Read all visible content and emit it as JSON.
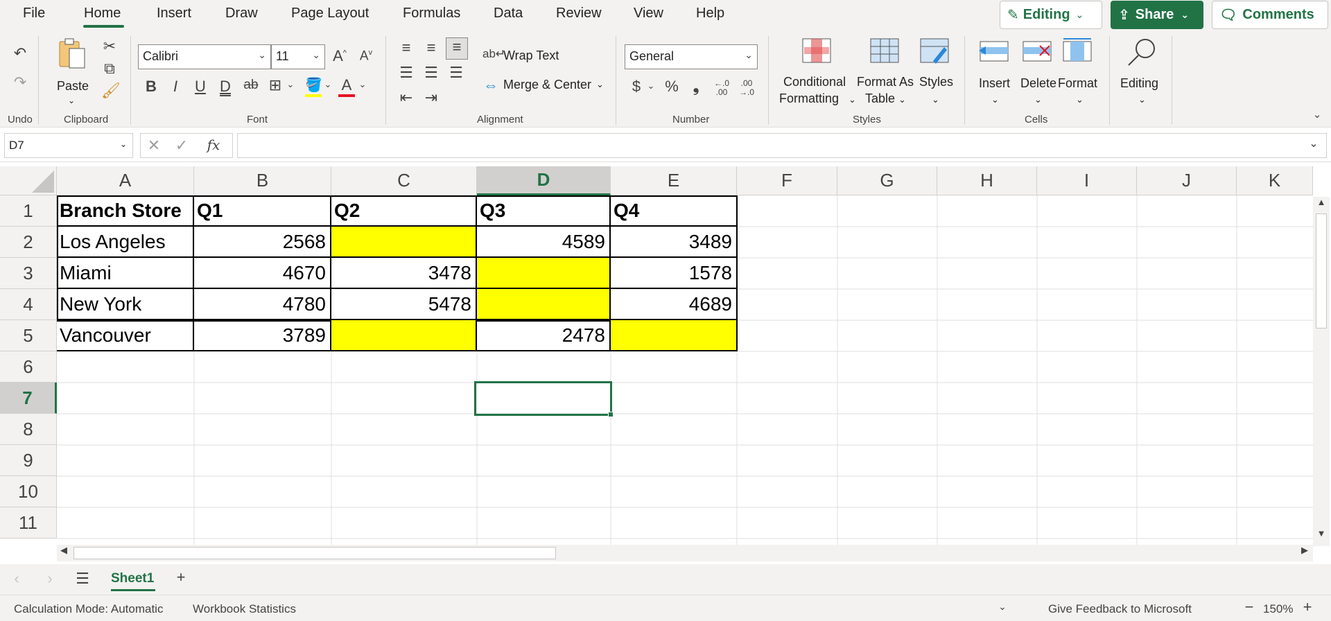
{
  "menu": {
    "tabs": [
      "File",
      "Home",
      "Insert",
      "Draw",
      "Page Layout",
      "Formulas",
      "Data",
      "Review",
      "View",
      "Help"
    ],
    "active_tab": "Home",
    "editing_label": "Editing",
    "share_label": "Share",
    "comments_label": "Comments"
  },
  "ribbon": {
    "undo_label": "Undo",
    "clipboard": {
      "paste_label": "Paste",
      "group_label": "Clipboard"
    },
    "font": {
      "name": "Calibri",
      "size": "11",
      "group_label": "Font",
      "bold": "B",
      "italic": "I",
      "underline": "U",
      "double_underline": "D",
      "strike": "ab"
    },
    "alignment": {
      "wrap_text": "Wrap Text",
      "merge_center": "Merge & Center",
      "group_label": "Alignment"
    },
    "number": {
      "format": "General",
      "currency": "$",
      "percent": "%",
      "comma": "❟",
      "increase_decimal": "←.0 .00",
      "decrease_decimal": ".00 →.0",
      "group_label": "Number"
    },
    "styles": {
      "conditional_1": "Conditional",
      "conditional_2": "Formatting",
      "format_as_1": "Format As",
      "format_as_2": "Table",
      "styles_label": "Styles",
      "group_label": "Styles"
    },
    "cells": {
      "insert": "Insert",
      "delete": "Delete",
      "format": "Format",
      "group_label": "Cells"
    },
    "editing": {
      "label": "Editing"
    }
  },
  "formula_bar": {
    "name_box": "D7",
    "fx": "fx",
    "formula": ""
  },
  "grid": {
    "columns": [
      "A",
      "B",
      "C",
      "D",
      "E",
      "F",
      "G",
      "H",
      "I",
      "J",
      "K"
    ],
    "rows": [
      "1",
      "2",
      "3",
      "4",
      "5",
      "6",
      "7",
      "8",
      "9",
      "10",
      "11"
    ],
    "selected_column": "D",
    "selected_row": "7",
    "table": {
      "headers": [
        "Branch Store",
        "Q1",
        "Q2",
        "Q3",
        "Q4"
      ],
      "rows": [
        [
          "Los Angeles",
          "2568",
          "",
          "4589",
          "3489"
        ],
        [
          "Miami",
          "4670",
          "3478",
          "",
          "1578"
        ],
        [
          "New York",
          "4780",
          "5478",
          "",
          "4689"
        ],
        [
          "Vancouver",
          "3789",
          "",
          "2478",
          ""
        ]
      ]
    },
    "highlight_color": "#ffff00",
    "accent_color": "#217346"
  },
  "sheets": {
    "tabs": [
      "Sheet1"
    ],
    "active": "Sheet1"
  },
  "status": {
    "calc_mode": "Calculation Mode: Automatic",
    "workbook_stats": "Workbook Statistics",
    "feedback": "Give Feedback to Microsoft",
    "zoom": "150%"
  }
}
